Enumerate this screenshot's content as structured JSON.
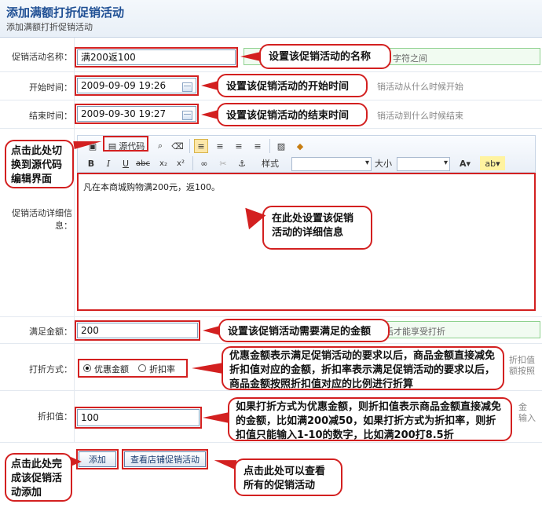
{
  "header": {
    "title": "添加满额打折促销活动",
    "subtitle": "添加满额打折促销活动"
  },
  "form": {
    "name": {
      "label": "促销活动名称：",
      "value": "满200返100",
      "hint": "字符之间"
    },
    "start": {
      "label": "开始时间：",
      "value": "2009-09-09 19:26",
      "hint": "销活动从什么时候开始"
    },
    "end": {
      "label": "结束时间：",
      "value": "2009-09-30 19:27",
      "hint": "销活动到什么时候结束"
    },
    "detail": {
      "label": "促销活动详细信息：",
      "content": "凡在本商城购物满200元，返100。",
      "toolbar": {
        "source": "源代码",
        "style_label": "样式",
        "size_label": "大小"
      }
    },
    "amount": {
      "label": "满足金额：",
      "value": "200",
      "hint": "后才能享受打折"
    },
    "mode": {
      "label": "打折方式：",
      "options": [
        "优惠金额",
        "折扣率"
      ],
      "selected": "优惠金额",
      "hint1": "折扣值",
      "hint2": "额按照"
    },
    "discount": {
      "label": "折扣值：",
      "value": "100",
      "hint1": "金",
      "hint2": "输入"
    },
    "buttons": {
      "add": "添加",
      "view": "查看店铺促销活动"
    }
  },
  "callouts": {
    "name": "设置该促销活动的名称",
    "start": "设置该促销活动的开始时间",
    "end": "设置该促销活动的结束时间",
    "source": "点击此处切换到源代码编辑界面",
    "detail": "在此处设置该促销活动的详细信息",
    "amount": "设置该促销活动需要满足的金额",
    "mode": "优惠金额表示满足促销活动的要求以后，商品金额直接减免折扣值对应的金额，折扣率表示满足促销活动的要求以后，商品金额按照折扣值对应的比例进行折算",
    "discount": "如果打折方式为优惠金额，则折扣值表示商品金额直接减免的金额，比如满200减50，如果打折方式为折扣率，则折扣值只能输入1-10的数字，比如满200打8.5折",
    "add": "点击此处完成该促销活动添加",
    "view": "点击此处可以查看所有的促销活动"
  }
}
